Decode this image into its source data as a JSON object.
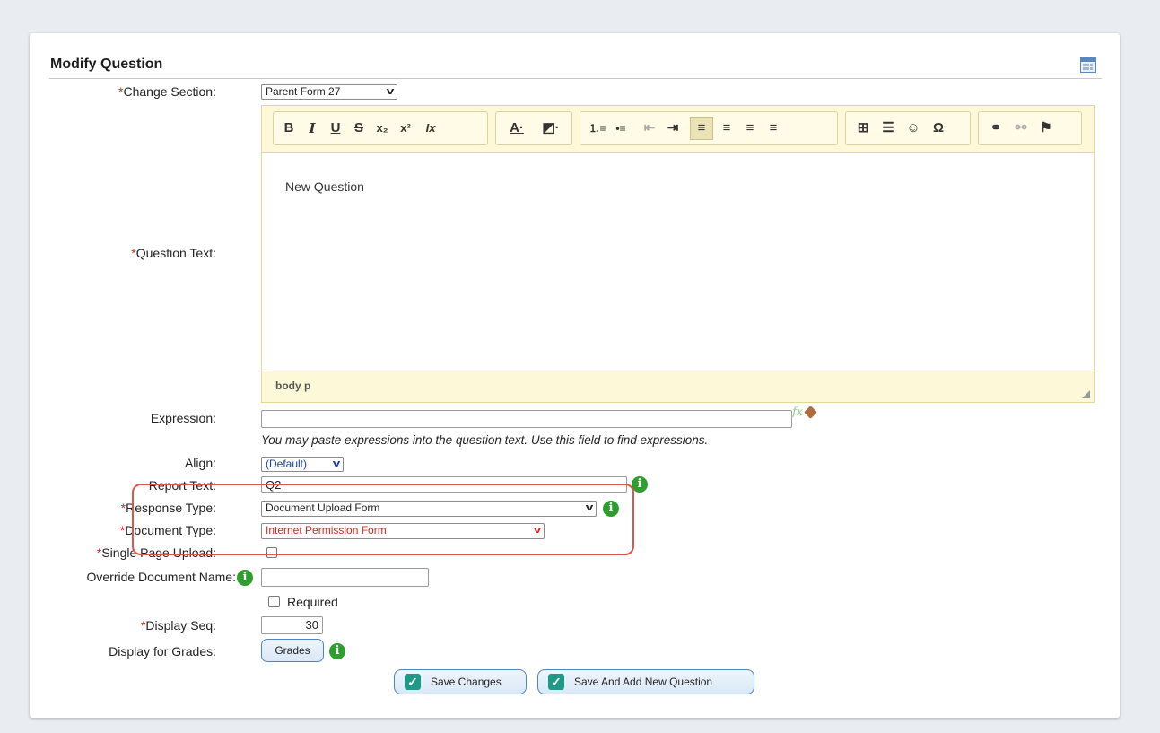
{
  "form": {
    "title": "Modify Question",
    "required_mark": "*",
    "fields": {
      "change_section": {
        "label": "Change Section:",
        "value": "Parent Form 27"
      },
      "question_text": {
        "label": "Question Text:",
        "content": "New Question",
        "path": "body  p"
      },
      "expression": {
        "label": "Expression:",
        "value": "",
        "hint": "You may paste expressions into the question text. Use this field to find expressions.",
        "fx": "fx"
      },
      "align": {
        "label": "Align:",
        "value": "(Default)"
      },
      "report_text": {
        "label": "Report Text:",
        "value": "Q2"
      },
      "response_type": {
        "label": "Response Type:",
        "value": "Document Upload Form"
      },
      "document_type": {
        "label": "Document Type:",
        "value": "Internet Permission Form"
      },
      "single_page_upload": {
        "label": "Single Page Upload:"
      },
      "override_document_name": {
        "label": "Override Document Name:",
        "value": ""
      },
      "required": {
        "label": "Required"
      },
      "display_seq": {
        "label": "Display Seq:",
        "value": "30"
      },
      "display_for_grades": {
        "label": "Display for Grades:",
        "button": "Grades"
      }
    },
    "buttons": {
      "save_changes": "Save Changes",
      "save_and_add": "Save And Add New Question"
    },
    "info_glyph": "i"
  },
  "toolbar": {
    "bold": "B",
    "italic": "I",
    "underline": "U",
    "strike": "S",
    "subscript": "x₂",
    "superscript": "x²",
    "remove_format": "Ix",
    "text_color": "A·",
    "bg_color": "◩·",
    "numbered_list": "⒈≡",
    "bullet_list": "•≡",
    "outdent": "⇤",
    "indent": "⇥",
    "align_left": "≡",
    "align_center": "≡",
    "align_right": "≡",
    "justify": "≡",
    "table": "⊞",
    "hr": "☰",
    "smiley": "☺",
    "omega": "Ω",
    "link": "⚭",
    "unlink": "⚯",
    "anchor": "⚑"
  },
  "colors": {
    "required": "#d9251c",
    "document_type_text": "#d9251c",
    "align_text": "#1a3fa8",
    "highlight": "#d9574a",
    "info": "#2e9e2e",
    "save_check": "#1f9a86"
  }
}
